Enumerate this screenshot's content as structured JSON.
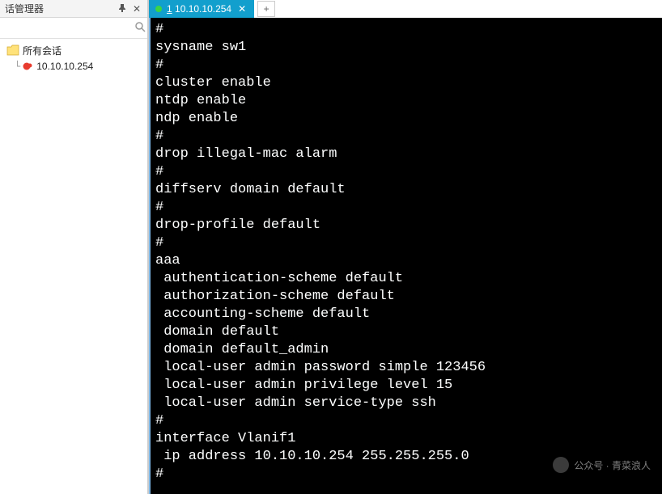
{
  "sidebar": {
    "title": "话管理器",
    "pin_glyph": "📌",
    "close_glyph": "✕",
    "search_glyph": "🔍",
    "search_placeholder": "",
    "root_label": "所有会话",
    "items": [
      {
        "label": "10.10.10.254"
      }
    ]
  },
  "tabs": {
    "active": {
      "index": "1",
      "title": "10.10.10.254",
      "close": "✕"
    },
    "new_tab_glyph": "+"
  },
  "terminal": {
    "lines": [
      "#",
      "sysname sw1",
      "#",
      "cluster enable",
      "ntdp enable",
      "ndp enable",
      "#",
      "drop illegal-mac alarm",
      "#",
      "diffserv domain default",
      "#",
      "drop-profile default",
      "#",
      "aaa",
      " authentication-scheme default",
      " authorization-scheme default",
      " accounting-scheme default",
      " domain default",
      " domain default_admin",
      " local-user admin password simple 123456",
      " local-user admin privilege level 15",
      " local-user admin service-type ssh",
      "#",
      "interface Vlanif1",
      " ip address 10.10.10.254 255.255.255.0",
      "#"
    ]
  },
  "watermark": {
    "text": "公众号 · 青菜浪人"
  }
}
